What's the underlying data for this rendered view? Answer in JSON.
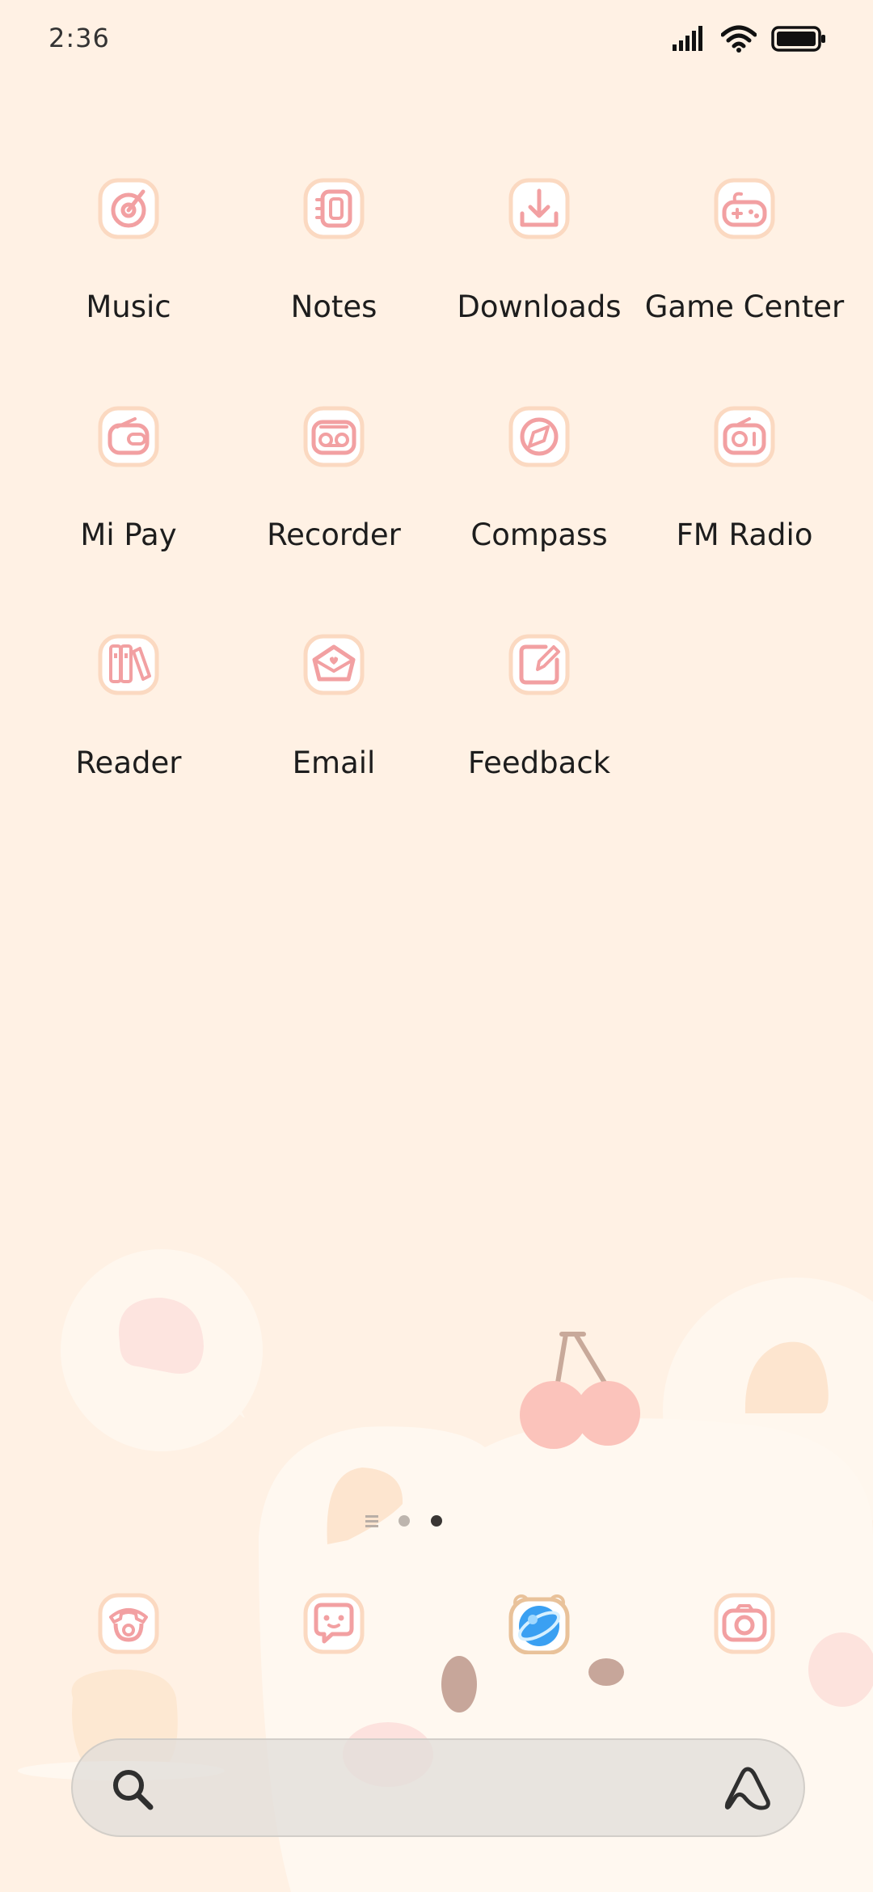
{
  "status_bar": {
    "time": "2:36",
    "icons": [
      "signal-icon",
      "wifi-icon",
      "battery-icon"
    ]
  },
  "apps": [
    {
      "name": "music",
      "label": "Music",
      "icon": "music-icon"
    },
    {
      "name": "notes",
      "label": "Notes",
      "icon": "notes-icon"
    },
    {
      "name": "downloads",
      "label": "Downloads",
      "icon": "download-icon"
    },
    {
      "name": "game-center",
      "label": "Game Center",
      "icon": "gamepad-icon"
    },
    {
      "name": "mi-pay",
      "label": "Mi Pay",
      "icon": "wallet-icon"
    },
    {
      "name": "recorder",
      "label": "Recorder",
      "icon": "recorder-icon"
    },
    {
      "name": "compass",
      "label": "Compass",
      "icon": "compass-icon"
    },
    {
      "name": "fm-radio",
      "label": "FM Radio",
      "icon": "radio-icon"
    },
    {
      "name": "reader",
      "label": "Reader",
      "icon": "books-icon"
    },
    {
      "name": "email",
      "label": "Email",
      "icon": "envelope-icon"
    },
    {
      "name": "feedback",
      "label": "Feedback",
      "icon": "edit-icon"
    }
  ],
  "page_indicator": {
    "pages": 3,
    "current": 3
  },
  "dock": [
    "phone-icon",
    "messages-icon",
    "browser-icon",
    "camera-icon"
  ],
  "search": {
    "icons": [
      "search-icon",
      "assistant-icon"
    ]
  },
  "colors": {
    "background": "#fff1e4",
    "icon_stroke": "#f2a0a2",
    "icon_ring": "#fbd9c1",
    "browser_blue": "#3aa0f2",
    "label": "#1d1d1d"
  }
}
